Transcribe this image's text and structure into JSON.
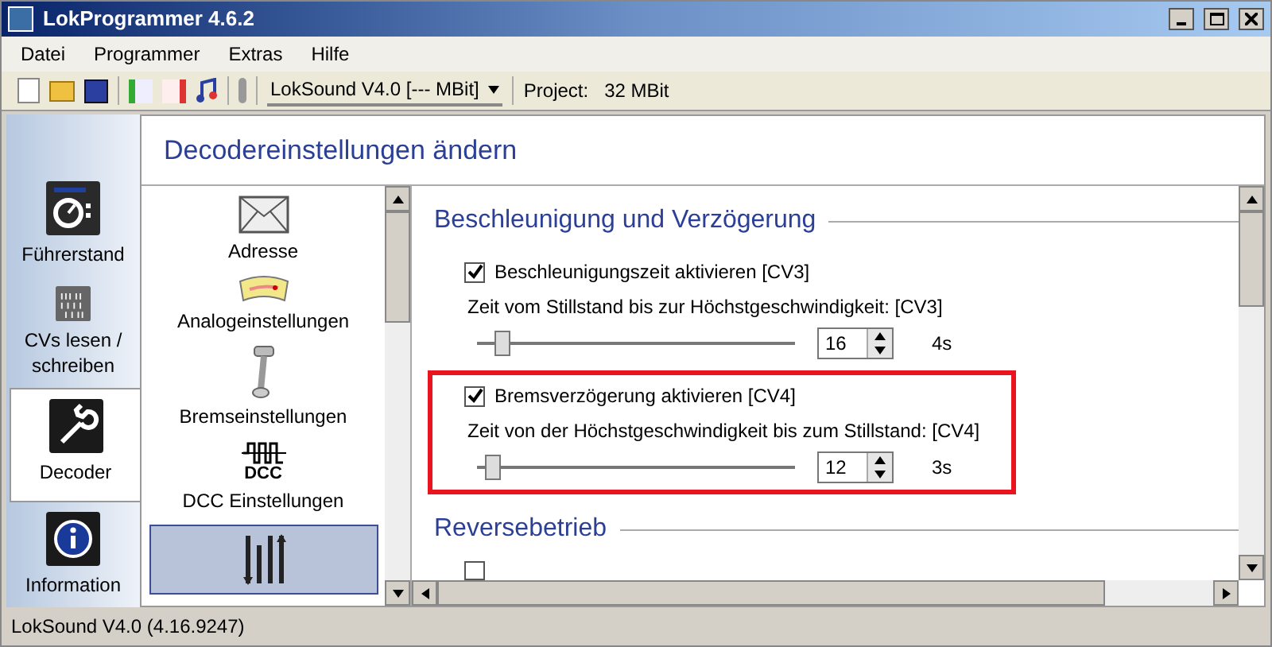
{
  "window": {
    "title": "LokProgrammer 4.6.2"
  },
  "menu": [
    "Datei",
    "Programmer",
    "Extras",
    "Hilfe"
  ],
  "toolbar": {
    "decoder_select": "LokSound V4.0 [--- MBit]",
    "project_label": "Project:",
    "project_value": "32 MBit"
  },
  "nav": [
    {
      "label": "Führerstand",
      "kind": "cab",
      "selected": false
    },
    {
      "label": "CVs lesen / schreiben",
      "kind": "binary",
      "selected": false
    },
    {
      "label": "Decoder",
      "kind": "wrench",
      "selected": true
    },
    {
      "label": "Information",
      "kind": "info",
      "selected": false
    }
  ],
  "page_title": "Decodereinstellungen ändern",
  "categories": [
    {
      "label": "Adresse",
      "kind": "envelope",
      "selected": false
    },
    {
      "label": "Analogeinstellungen",
      "kind": "gauge",
      "selected": false
    },
    {
      "label": "Bremseinstellungen",
      "kind": "brake",
      "selected": false
    },
    {
      "label": "DCC Einstellungen",
      "kind": "dcc",
      "icon_text": "DCC",
      "selected": false
    },
    {
      "kind": "sliders",
      "selected": true
    }
  ],
  "section": {
    "title": "Beschleunigung und Verzögerung",
    "groups": [
      {
        "checkbox": "Beschleunigungszeit aktivieren [CV3]",
        "checked": true,
        "caption": "Zeit vom Stillstand bis zur Höchstgeschwindigkeit: [CV3]",
        "level": 0.08,
        "value": "16",
        "reading": "4s",
        "highlighted": false
      },
      {
        "checkbox": "Bremsverzögerung aktivieren [CV4]",
        "checked": true,
        "caption": "Zeit von der Höchstgeschwindigkeit bis zum Stillstand: [CV4]",
        "level": 0.05,
        "value": "12",
        "reading": "3s",
        "highlighted": true
      }
    ]
  },
  "section2": {
    "title": "Reversebetrieb",
    "checked": false
  },
  "status_bar": "LokSound V4.0 (4.16.9247)"
}
